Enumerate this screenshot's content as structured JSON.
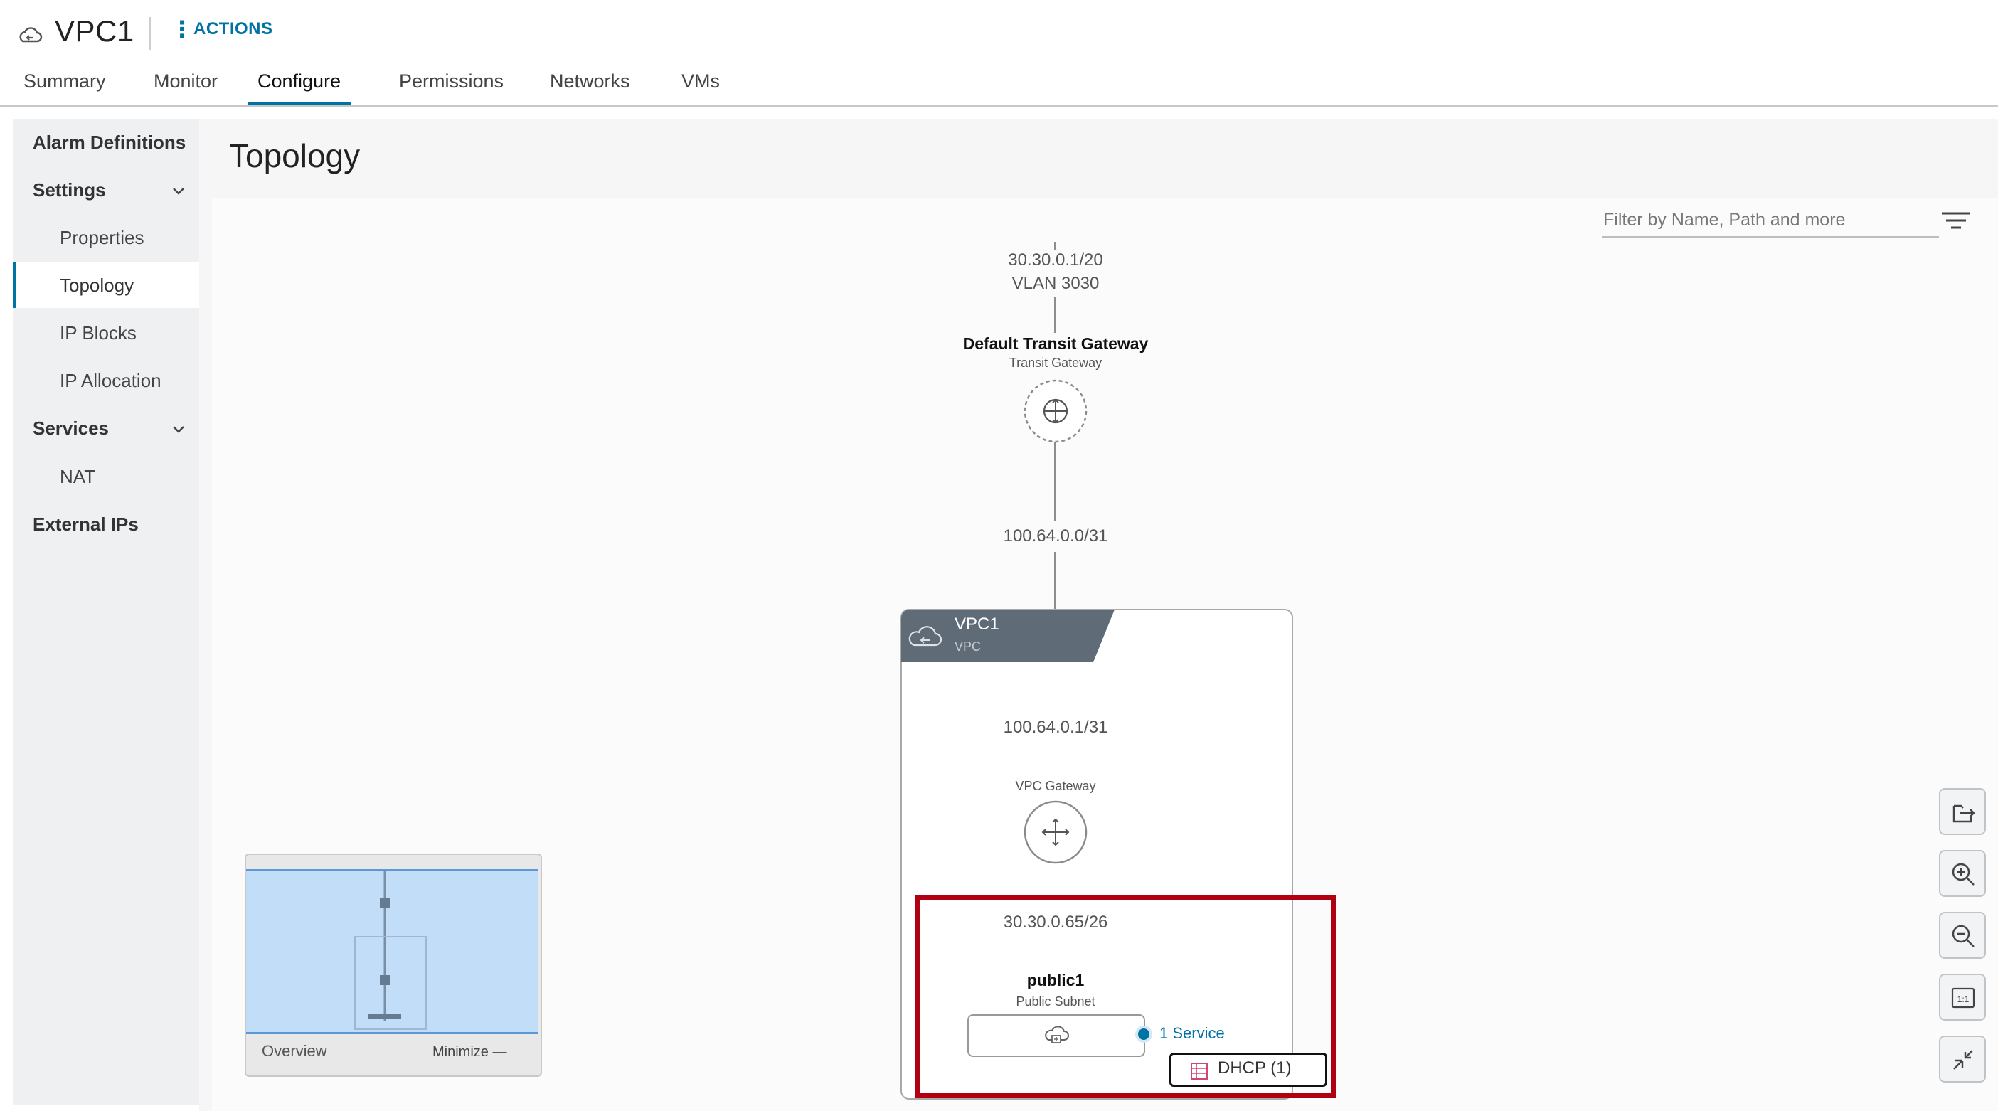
{
  "header": {
    "title": "VPC1",
    "title_icon": "vpc-cloud-icon",
    "actions_label": "ACTIONS"
  },
  "tabs": [
    {
      "label": "Summary"
    },
    {
      "label": "Monitor"
    },
    {
      "label": "Configure",
      "active": true
    },
    {
      "label": "Permissions"
    },
    {
      "label": "Networks"
    },
    {
      "label": "VMs"
    }
  ],
  "sidebar": {
    "items": [
      {
        "label": "Alarm Definitions"
      },
      {
        "label": "Settings",
        "expanded": true
      },
      {
        "label": "Properties"
      },
      {
        "label": "Topology",
        "selected": true
      },
      {
        "label": "IP Blocks"
      },
      {
        "label": "IP Allocation"
      },
      {
        "label": "Services",
        "expanded": true
      },
      {
        "label": "NAT"
      },
      {
        "label": "External IPs"
      }
    ]
  },
  "page": {
    "title": "Topology",
    "filter_placeholder": "Filter by Name, Path and more"
  },
  "topology": {
    "uplink_cidr": "30.30.0.1/20",
    "uplink_vlan": "VLAN 3030",
    "transit_gateway": {
      "name": "Default Transit Gateway",
      "type": "Transit Gateway"
    },
    "transit_link": "100.64.0.0/31",
    "vpc": {
      "name": "VPC1",
      "type": "VPC"
    },
    "vpc_link": "100.64.0.1/31",
    "vpc_gateway": {
      "type": "VPC Gateway"
    },
    "subnet": {
      "cidr": "30.30.0.65/26",
      "name": "public1",
      "type": "Public Subnet"
    },
    "service_link": "1 Service",
    "dhcp_chip": "DHCP (1)"
  },
  "overview": {
    "label": "Overview",
    "minimize_label": "Minimize —"
  },
  "toolbar": {
    "buttons": [
      "export-icon",
      "zoom-in-icon",
      "zoom-out-icon",
      "actual-size-icon",
      "collapse-icon"
    ],
    "actual_size_label": "1:1"
  },
  "colors": {
    "accent": "#0072a3",
    "highlight": "#b00012",
    "vpc_header": "#5f6b77"
  }
}
